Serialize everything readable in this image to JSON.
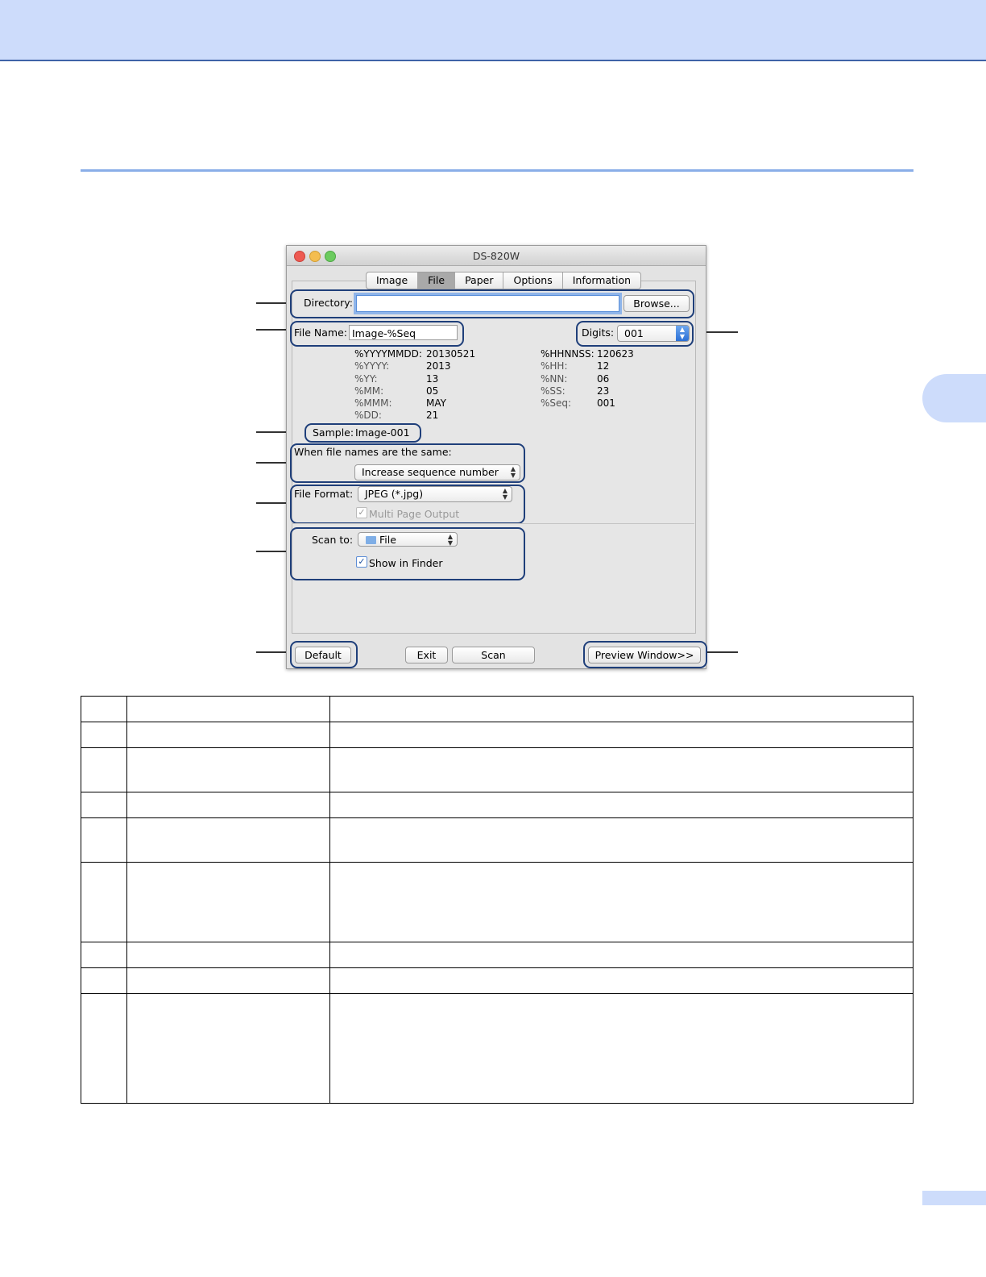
{
  "window": {
    "title": "DS-820W",
    "tabs": [
      "Image",
      "File",
      "Paper",
      "Options",
      "Information"
    ],
    "active_tab": "File",
    "directory": {
      "label": "Directory:",
      "value": "",
      "browse_label": "Browse..."
    },
    "file_name": {
      "label": "File Name:",
      "value": "Image-%Seq"
    },
    "digits": {
      "label": "Digits:",
      "value": "001"
    },
    "variables_left": [
      {
        "key": "%YYYYMMDD:",
        "value": "20130521"
      },
      {
        "key": "%YYYY:",
        "value": "2013"
      },
      {
        "key": "%YY:",
        "value": "13"
      },
      {
        "key": "%MM:",
        "value": "05"
      },
      {
        "key": "%MMM:",
        "value": "MAY"
      },
      {
        "key": "%DD:",
        "value": "21"
      }
    ],
    "variables_right": [
      {
        "key": "%HHNNSS:",
        "value": "120623"
      },
      {
        "key": "%HH:",
        "value": "12"
      },
      {
        "key": "%NN:",
        "value": "06"
      },
      {
        "key": "%SS:",
        "value": "23"
      },
      {
        "key": "%Seq:",
        "value": "001"
      }
    ],
    "sample": {
      "label": "Sample:",
      "value": "Image-001"
    },
    "same_names": {
      "label": "When file names are the same:",
      "value": "Increase sequence number"
    },
    "file_format": {
      "label": "File Format:",
      "value": "JPEG (*.jpg)",
      "multi_page_label": "Multi Page Output",
      "multi_page_checked": true
    },
    "scan_to": {
      "label": "Scan to:",
      "value": "File",
      "show_in_finder_label": "Show in Finder",
      "show_in_finder_checked": true
    },
    "buttons": {
      "default": "Default",
      "exit": "Exit",
      "scan": "Scan",
      "preview": "Preview Window>>"
    }
  },
  "table": {
    "rows": [
      [
        "",
        "",
        ""
      ],
      [
        "",
        "",
        ""
      ],
      [
        "",
        "",
        ""
      ],
      [
        "",
        "",
        ""
      ],
      [
        "",
        "",
        ""
      ],
      [
        "",
        "",
        ""
      ],
      [
        "",
        "",
        ""
      ],
      [
        "",
        "",
        ""
      ],
      [
        "",
        "",
        ""
      ]
    ]
  }
}
